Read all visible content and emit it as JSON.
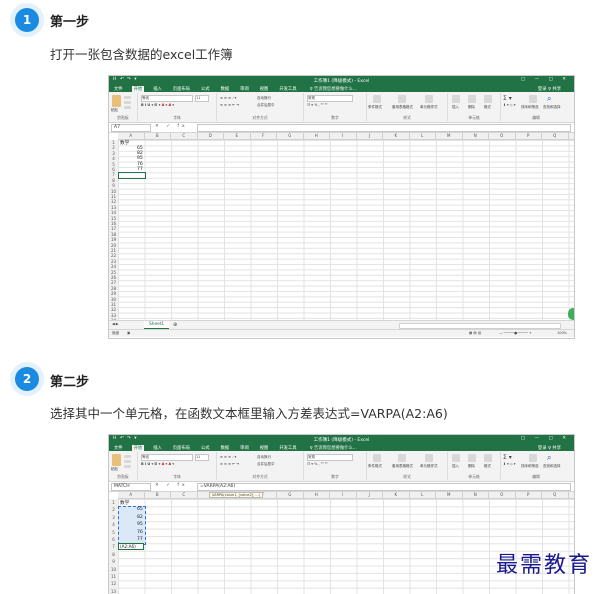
{
  "steps": [
    {
      "number": "1",
      "title": "第一步",
      "desc": "打开一张包含数据的excel工作簿"
    },
    {
      "number": "2",
      "title": "第二步",
      "desc": "选择其中一个单元格，在函数文本框里输入方差表达式=VARPA(A2:A6)"
    }
  ],
  "excel1": {
    "window_title": "工作簿1 (降级模式) - Excel",
    "qat": "H ↶ ↷ ▾",
    "win_controls": "□ — □ ✕",
    "tabs": [
      "文件",
      "开始",
      "插入",
      "页面布局",
      "公式",
      "数据",
      "审阅",
      "视图",
      "开发工具"
    ],
    "active_tab": "开始",
    "tell_me": "♀ 告诉我您想要做什么...",
    "signin": "登录  ♀ 共享",
    "ribbon_groups": [
      "剪贴板",
      "字体",
      "对齐方式",
      "数字",
      "样式",
      "单元格",
      "编辑"
    ],
    "ribbon_items": {
      "paste": "粘贴",
      "font": "等线",
      "size": "11",
      "wrap": "自动换行",
      "merge": "合并后居中",
      "general": "常规",
      "cond": "条件格式",
      "table": "套用表格格式",
      "styles": "单元格样式",
      "insert": "插入",
      "delete": "删除",
      "format": "格式",
      "sort": "排序和筛选",
      "find": "查找和选择"
    },
    "name_box": "A7",
    "formula_icons": "✕ ✓ fx",
    "formula": "",
    "columns": [
      "A",
      "B",
      "C",
      "D",
      "E",
      "F",
      "G",
      "H",
      "I",
      "J",
      "K",
      "L",
      "M",
      "N",
      "O",
      "P",
      "Q"
    ],
    "rows": [
      "1",
      "2",
      "3",
      "4",
      "5",
      "6",
      "7",
      "8",
      "9",
      "10",
      "11",
      "12",
      "13",
      "14",
      "15",
      "16",
      "17",
      "18",
      "19",
      "20",
      "21",
      "22",
      "23",
      "24",
      "25",
      "26",
      "27",
      "28",
      "29",
      "30",
      "31",
      "32",
      "33",
      "34"
    ],
    "data": [
      "数学",
      "65",
      "82",
      "95",
      "76",
      "77"
    ],
    "sheet": "Sheet1",
    "status": "就绪",
    "zoom": "100%"
  },
  "excel2": {
    "window_title": "工作簿1 (降级模式) - Excel",
    "qat": "H ↶ ↷ ▾",
    "win_controls": "□ — □ ✕",
    "tabs": [
      "文件",
      "开始",
      "插入",
      "页面布局",
      "公式",
      "数据",
      "审阅",
      "视图",
      "开发工具"
    ],
    "active_tab": "开始",
    "tell_me": "♀ 告诉我您想要做什么...",
    "signin": "登录  ♀ 共享",
    "ribbon_groups": [
      "剪贴板",
      "字体",
      "对齐方式",
      "数字",
      "样式",
      "单元格",
      "编辑"
    ],
    "ribbon_items": {
      "paste": "粘贴",
      "font": "等线",
      "size": "11",
      "wrap": "自动换行",
      "merge": "合并后居中",
      "general": "常规",
      "cond": "条件格式",
      "table": "套用表格格式",
      "styles": "单元格样式",
      "insert": "插入",
      "delete": "删除",
      "format": "格式",
      "sort": "排序和筛选",
      "find": "查找和选择"
    },
    "name_box": "MATCH",
    "formula_icons": "✕ ✓ fx",
    "formula": "=VARPA(A2:A6)",
    "tooltip": "VARPA(value1, [value2], ...)",
    "columns": [
      "A",
      "B",
      "C",
      "D",
      "E",
      "F",
      "G",
      "H",
      "I",
      "J",
      "K",
      "L",
      "M",
      "N",
      "O",
      "P",
      "Q"
    ],
    "rows": [
      "1",
      "2",
      "3",
      "4",
      "5",
      "6",
      "7",
      "8",
      "9",
      "10",
      "11",
      "12",
      "13"
    ],
    "data": [
      "数学",
      "65",
      "82",
      "95",
      "76",
      "77"
    ],
    "edit_cell": "(A2:A6)"
  },
  "watermark": "最需教育",
  "colors": {
    "accent": "#1a8be0",
    "excel_green": "#217346"
  }
}
